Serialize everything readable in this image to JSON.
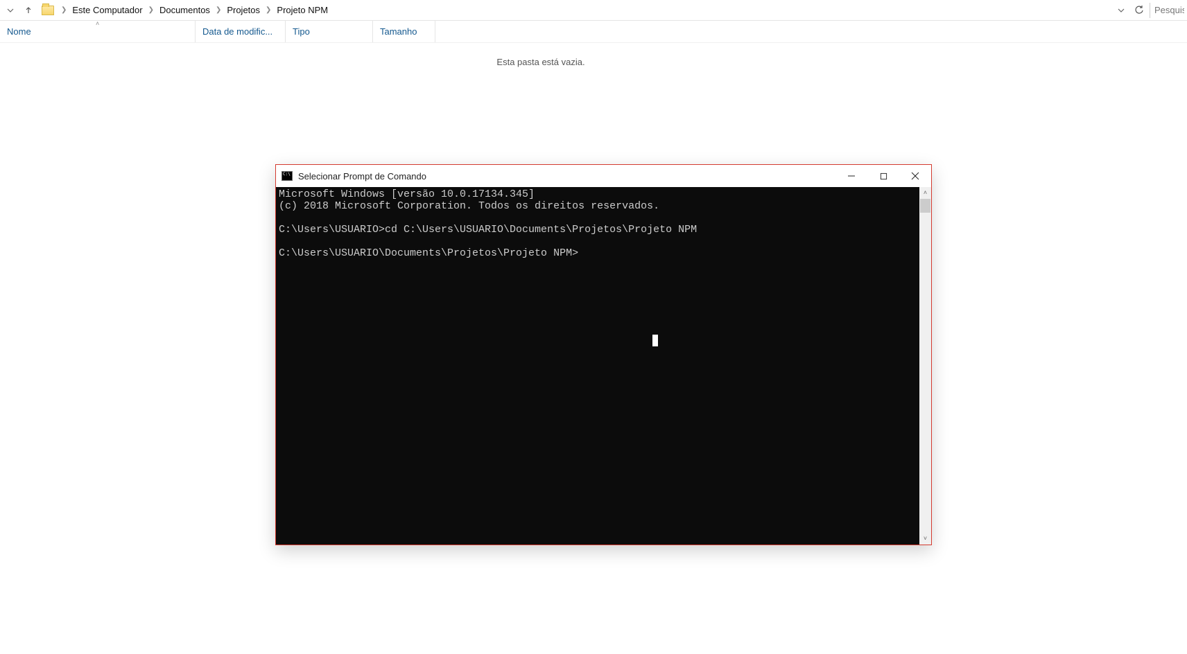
{
  "explorer": {
    "breadcrumbs": [
      "Este Computador",
      "Documentos",
      "Projetos",
      "Projeto NPM"
    ],
    "search_placeholder": "Pesquisa",
    "columns": {
      "name": "Nome",
      "date": "Data de modific...",
      "type": "Tipo",
      "size": "Tamanho"
    },
    "empty_message": "Esta pasta está vazia."
  },
  "cmd": {
    "title": "Selecionar Prompt de Comando",
    "lines": {
      "l1": "Microsoft Windows [versão 10.0.17134.345]",
      "l2": "(c) 2018 Microsoft Corporation. Todos os direitos reservados.",
      "l3": "",
      "l4": "C:\\Users\\USUARIO>cd C:\\Users\\USUARIO\\Documents\\Projetos\\Projeto NPM",
      "l5": "",
      "l6": "C:\\Users\\USUARIO\\Documents\\Projetos\\Projeto NPM>"
    }
  }
}
